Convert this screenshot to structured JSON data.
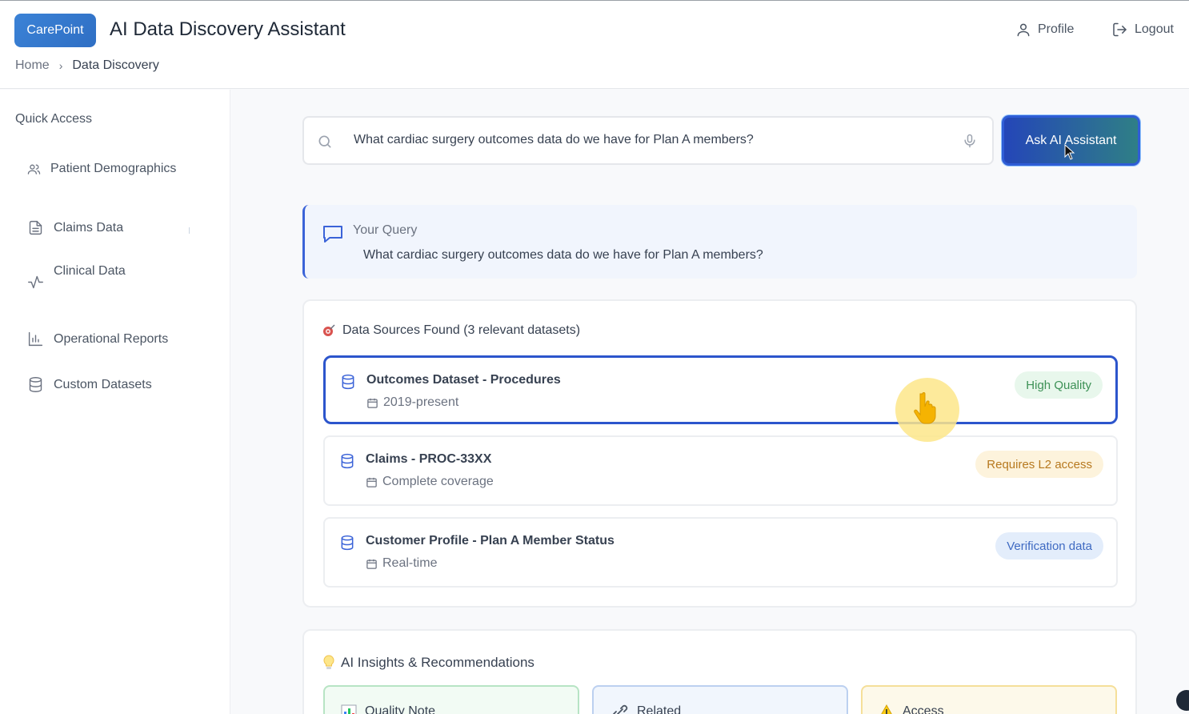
{
  "header": {
    "logo_text": "CarePoint",
    "title": "AI Data Discovery Assistant",
    "profile_label": "Profile",
    "logout_label": "Logout"
  },
  "breadcrumb": {
    "home": "Home",
    "current": "Data Discovery"
  },
  "sidebar": {
    "title": "Quick Access",
    "items": [
      {
        "label": "Patient Demographics",
        "icon": "users-icon"
      },
      {
        "label": "Claims Data",
        "icon": "document-icon"
      },
      {
        "label": "Clinical Data",
        "icon": "activity-icon"
      },
      {
        "label": "Operational Reports",
        "icon": "bar-chart-icon"
      },
      {
        "label": "Custom Datasets",
        "icon": "database-icon"
      }
    ]
  },
  "search": {
    "value": "What cardiac surgery outcomes data do we have for Plan A members?",
    "button_label": "Ask AI Assistant"
  },
  "query": {
    "label": "Your Query",
    "text": "What cardiac surgery outcomes data do we have for Plan A members?"
  },
  "sources": {
    "title": "Data Sources Found (3 relevant datasets)",
    "items": [
      {
        "name": "Outcomes Dataset - Procedures",
        "meta": "2019-present",
        "badge": "High Quality",
        "badge_color": "#3d9156"
      },
      {
        "name": "Claims - PROC-33XX",
        "meta": "Complete coverage",
        "badge": "Requires L2 access",
        "badge_color": "#b7791f"
      },
      {
        "name": "Customer Profile - Plan A Member Status",
        "meta": "Real-time",
        "badge": "Verification data",
        "badge_color": "#3f6ac2"
      }
    ]
  },
  "insights": {
    "title": "AI Insights & Recommendations",
    "cards": [
      {
        "label": "Quality Note",
        "icon": "chart-icon"
      },
      {
        "label": "Related",
        "icon": "link-icon"
      },
      {
        "label": "Access",
        "icon": "warning-icon"
      }
    ]
  },
  "colors": {
    "accent": "#2c55cc",
    "brand": "#3b82d6"
  }
}
